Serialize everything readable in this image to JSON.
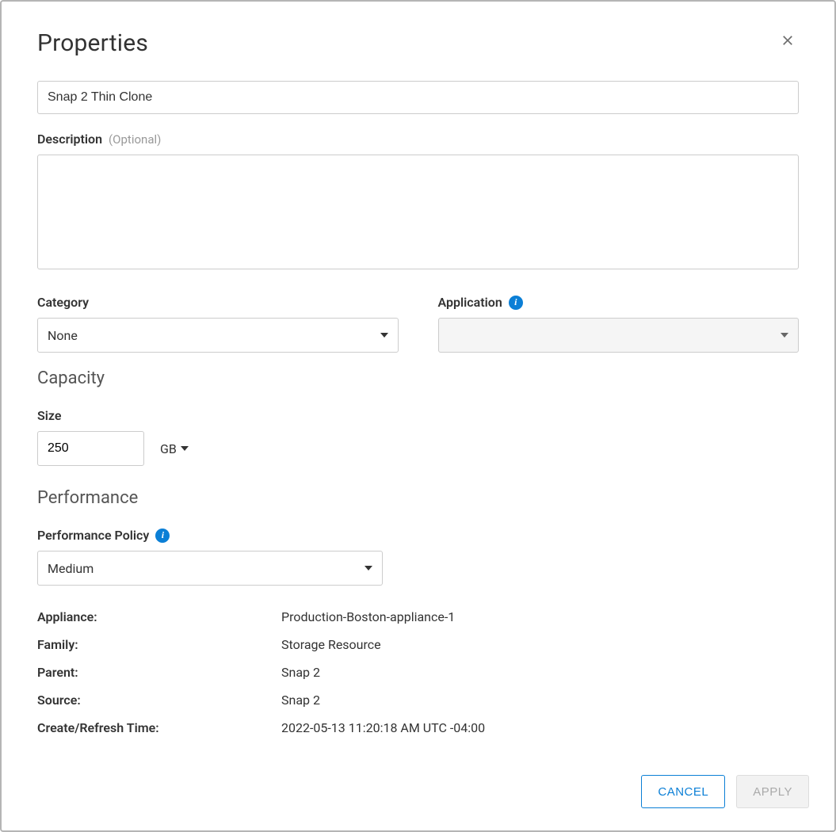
{
  "title": "Properties",
  "name_input": {
    "value": "Snap 2 Thin Clone"
  },
  "description": {
    "label": "Description",
    "optional": "(Optional)",
    "value": ""
  },
  "category": {
    "label": "Category",
    "value": "None"
  },
  "application": {
    "label": "Application",
    "value": ""
  },
  "capacity": {
    "heading": "Capacity",
    "size_label": "Size",
    "size_value": "250",
    "size_unit": "GB"
  },
  "performance": {
    "heading": "Performance",
    "policy_label": "Performance Policy",
    "policy_value": "Medium"
  },
  "meta": {
    "appliance": {
      "label": "Appliance:",
      "value": "Production-Boston-appliance-1"
    },
    "family": {
      "label": "Family:",
      "value": "Storage Resource"
    },
    "parent": {
      "label": "Parent:",
      "value": "Snap 2"
    },
    "source": {
      "label": "Source:",
      "value": "Snap 2"
    },
    "created": {
      "label": "Create/Refresh Time:",
      "value": "2022-05-13 11:20:18 AM UTC -04:00"
    }
  },
  "buttons": {
    "cancel": "CANCEL",
    "apply": "APPLY"
  }
}
